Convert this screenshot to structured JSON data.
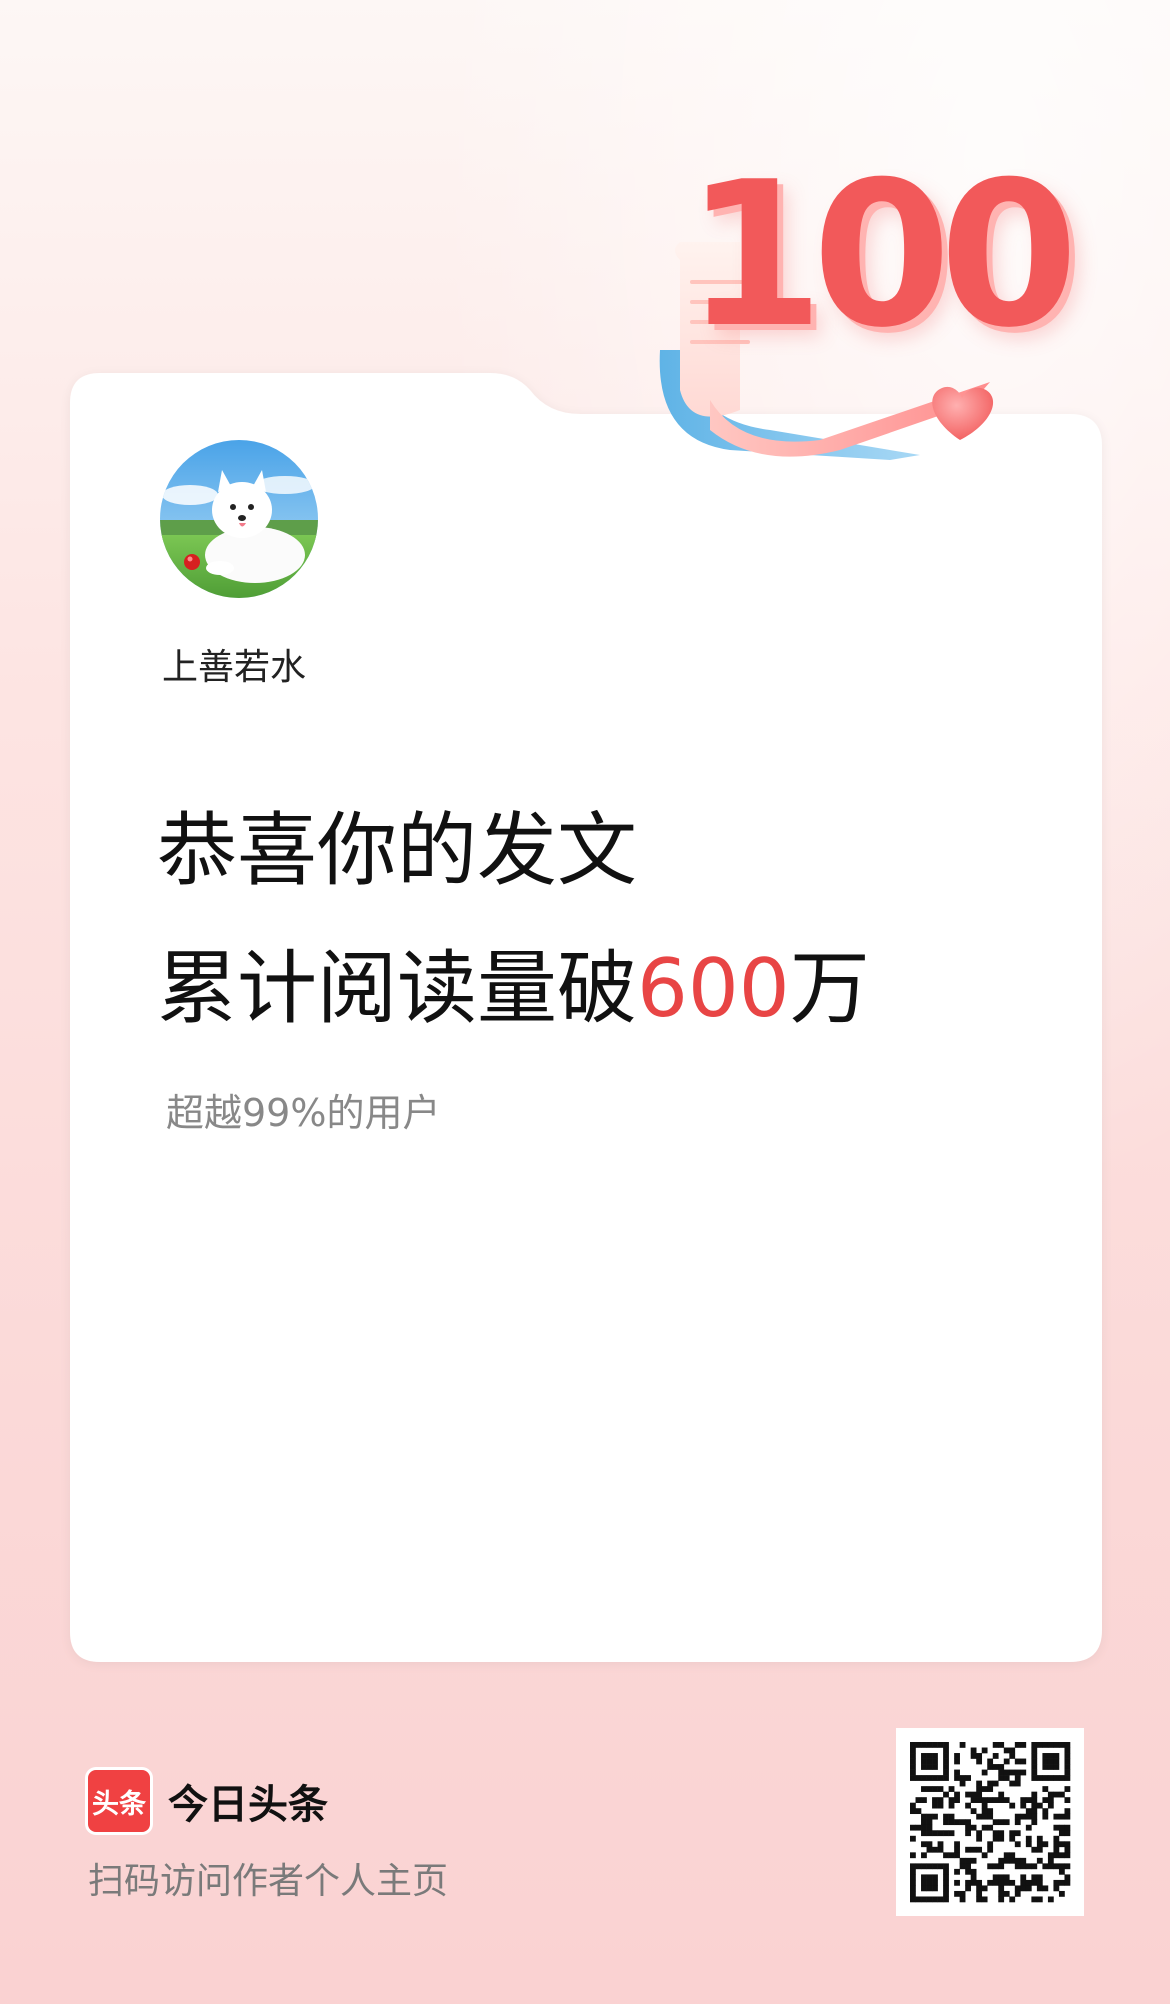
{
  "badge": {
    "number": "100"
  },
  "profile": {
    "username": "上善若水"
  },
  "headline": {
    "line1": "恭喜你的发文",
    "line2_prefix": "累计阅读量破",
    "line2_number": "600",
    "line2_suffix": "万"
  },
  "subtext": "超越99%的用户",
  "footer": {
    "logo_text": "头条",
    "brand_name": "今日头条",
    "scan_hint": "扫码访问作者个人主页"
  },
  "colors": {
    "accent": "#e84545",
    "brand": "#f04142"
  }
}
